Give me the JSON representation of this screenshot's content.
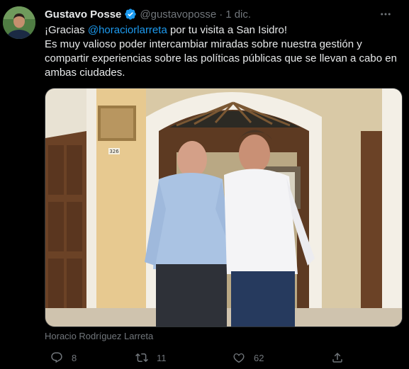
{
  "author": {
    "name": "Gustavo Posse",
    "handle": "@gustavoposse",
    "separator": "·",
    "date": "1 dic."
  },
  "tweet": {
    "line1_pre": "¡Gracias ",
    "mention": "@horaciorlarreta",
    "line1_post": " por tu visita a San Isidro!",
    "body": "Es muy valioso poder intercambiar miradas sobre nuestra gestión y compartir experiencias sobre las políticas públicas que se llevan a cabo en ambas ciudades."
  },
  "media": {
    "address_number": "326",
    "tagged_person": "Horacio Rodríguez Larreta"
  },
  "stats": {
    "replies": "8",
    "retweets": "11",
    "likes": "62"
  },
  "colors": {
    "background": "#000000",
    "text": "#e7e9ea",
    "muted": "#71767b",
    "accent": "#1d9bf0"
  },
  "icons": [
    "verified-badge-icon",
    "more-options-icon",
    "reply-icon",
    "retweet-icon",
    "like-icon",
    "share-icon"
  ]
}
